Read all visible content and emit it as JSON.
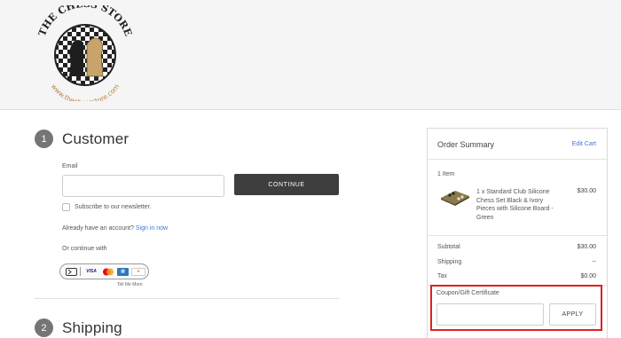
{
  "brand": {
    "name": "THE CHESS STORE",
    "url": "www.thechessstore.com"
  },
  "customer": {
    "step_number": "1",
    "title": "Customer",
    "email_label": "Email",
    "email_value": "",
    "continue_label": "CONTINUE",
    "newsletter_label": "Subscribe to our newsletter.",
    "account_prompt": "Already have an account?",
    "sign_in_label": "Sign in now",
    "or_continue": "Or continue with",
    "payment_cards": [
      "VISA",
      "MC",
      "AMEX",
      "DISCOVER"
    ],
    "tell_me_more": "Tell Me More"
  },
  "shipping": {
    "step_number": "2",
    "title": "Shipping"
  },
  "summary": {
    "title": "Order Summary",
    "edit_cart": "Edit Cart",
    "item_count": "1 Item",
    "item": {
      "description": "1 x Standard Club Silicone Chess Set Black & Ivory Pieces with Silicone Board - Green",
      "price": "$30.00"
    },
    "subtotal_label": "Subtotal",
    "subtotal_value": "$30.00",
    "shipping_label": "Shipping",
    "shipping_value": "--",
    "tax_label": "Tax",
    "tax_value": "$0.00",
    "coupon_label": "Coupon/Gift Certificate",
    "coupon_value": "",
    "apply_label": "APPLY"
  },
  "colors": {
    "accent_link": "#3a7bd5",
    "button_dark": "#3e3e3e",
    "highlight_red": "#e02020"
  }
}
